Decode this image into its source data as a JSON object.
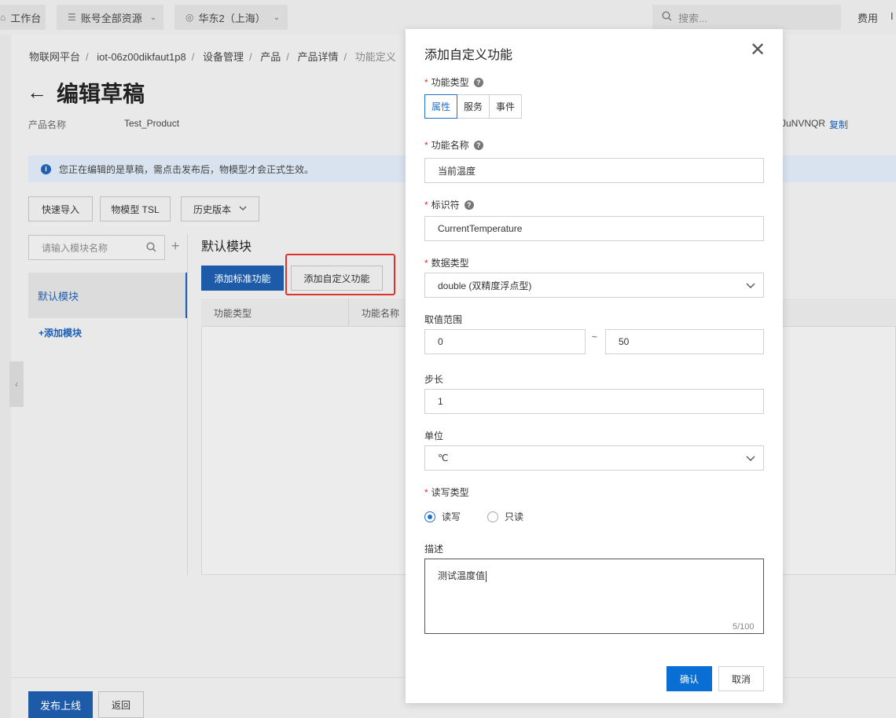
{
  "topbar": {
    "workbench": "工作台",
    "resources": "账号全部资源",
    "region": "华东2（上海）",
    "search_placeholder": "搜索...",
    "fee": "费用",
    "more": "I"
  },
  "breadcrumb": [
    "物联网平台",
    "iot-06z00dikfaut1p8",
    "设备管理",
    "产品",
    "产品详情",
    "功能定义"
  ],
  "page": {
    "title": "编辑草稿",
    "product_name_label": "产品名称",
    "product_name_value": "Test_Product",
    "product_key_partial": "JuNVNQR",
    "copy_label": "复制",
    "info_text": "您正在编辑的是草稿，需点击发布后，物模型才会正式生效。",
    "btn_quick_import": "快速导入",
    "btn_tsl": "物模型 TSL",
    "btn_history": "历史版本",
    "module_search_placeholder": "请输入模块名称",
    "default_module": "默认模块",
    "add_module": "+添加模块",
    "module_title": "默认模块",
    "btn_add_standard": "添加标准功能",
    "btn_add_custom": "添加自定义功能",
    "table_headers": [
      "功能类型",
      "功能名称"
    ],
    "btn_publish": "发布上线",
    "btn_back": "返回"
  },
  "modal": {
    "title": "添加自定义功能",
    "func_type_label": "功能类型",
    "func_type_options": [
      "属性",
      "服务",
      "事件"
    ],
    "func_type_selected": "属性",
    "func_name_label": "功能名称",
    "func_name_value": "当前温度",
    "identifier_label": "标识符",
    "identifier_value": "CurrentTemperature",
    "data_type_label": "数据类型",
    "data_type_value": "double (双精度浮点型)",
    "range_label": "取值范围",
    "range_min": "0",
    "range_sep": "~",
    "range_max": "50",
    "step_label": "步长",
    "step_value": "1",
    "unit_label": "单位",
    "unit_value": "℃",
    "rw_label": "读写类型",
    "rw_options": [
      "读写",
      "只读"
    ],
    "rw_selected": "读写",
    "desc_label": "描述",
    "desc_value": "测试温度值",
    "desc_counter": "5/100",
    "btn_ok": "确认",
    "btn_cancel": "取消"
  },
  "colors": {
    "primary": "#0a6fd4",
    "highlight": "#e0322c",
    "required": "#e0322c"
  }
}
